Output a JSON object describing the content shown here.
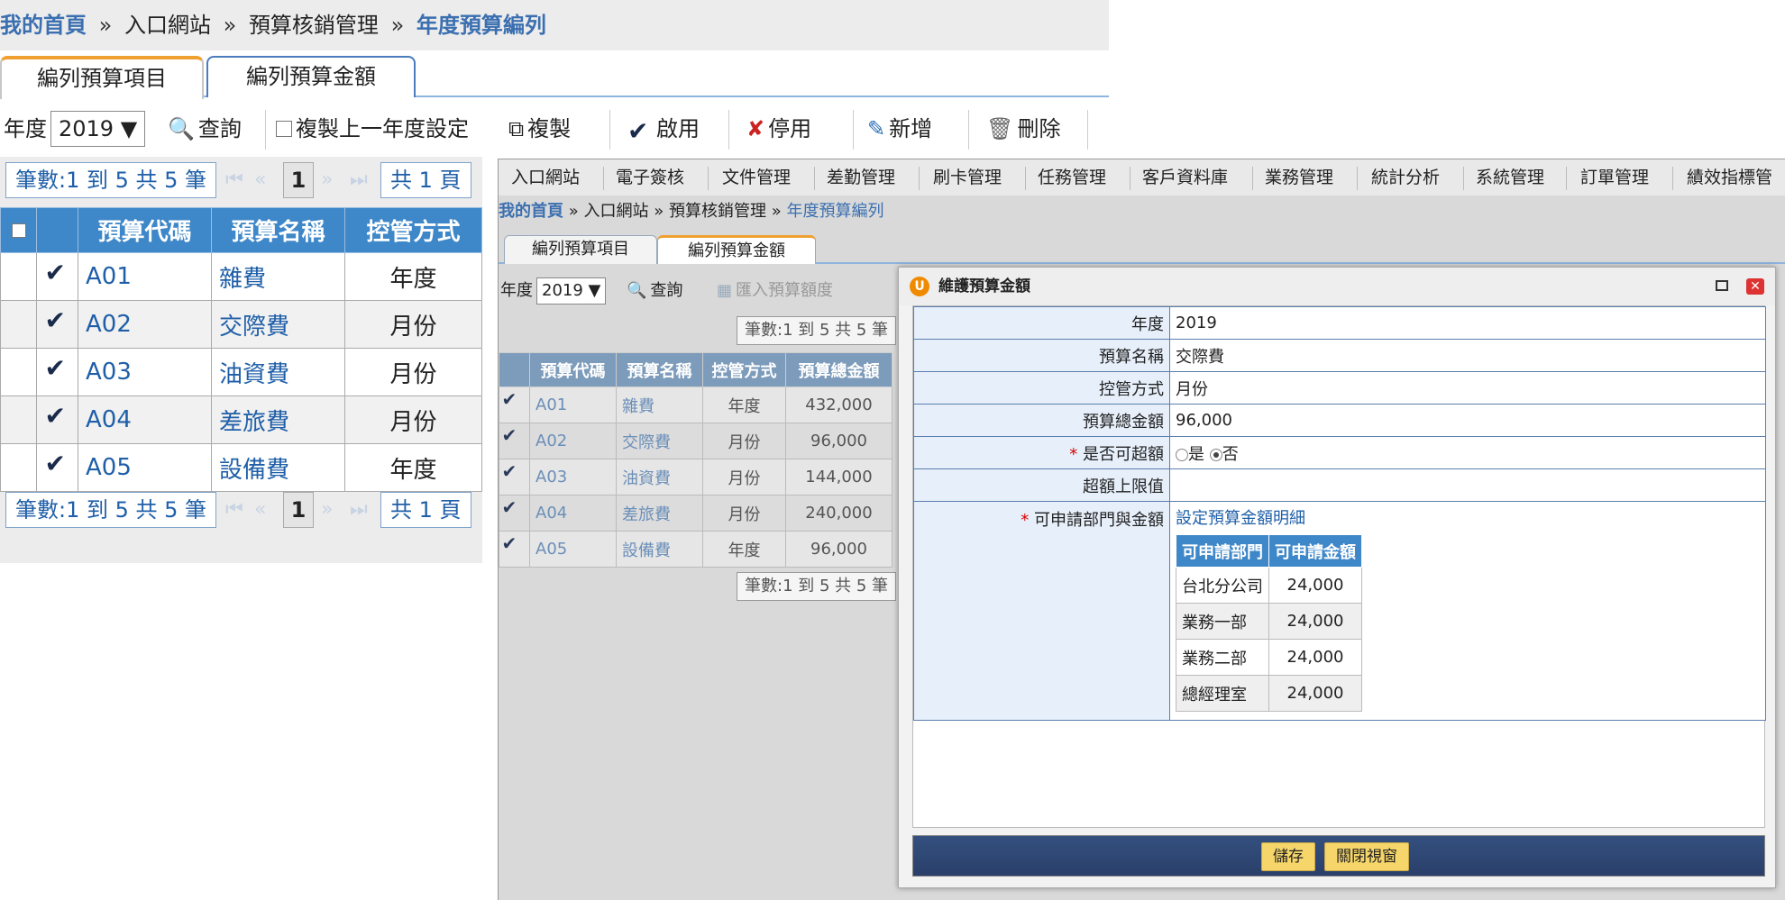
{
  "background_window": {
    "breadcrumb": [
      "我的首頁",
      "入口網站",
      "預算核銷管理",
      "年度預算編列"
    ],
    "breadcrumb_sep": "»",
    "tabs": [
      "編列預算項目",
      "編列預算金額"
    ],
    "toolbar": {
      "year_label": "年度",
      "year_value": "2019",
      "query": "查詢",
      "copy_prev": "複製上一年度設定",
      "copy": "複製",
      "enable": "啟用",
      "disable": "停用",
      "add": "新增",
      "delete": "刪除"
    },
    "pager": {
      "records": "筆數:1 到 5 共 5 筆",
      "page": "1",
      "total": "共 1 頁"
    },
    "columns": [
      "預算代碼",
      "預算名稱",
      "控管方式"
    ],
    "rows": [
      {
        "code": "A01",
        "name": "雜費",
        "control": "年度"
      },
      {
        "code": "A02",
        "name": "交際費",
        "control": "月份"
      },
      {
        "code": "A03",
        "name": "油資費",
        "control": "月份"
      },
      {
        "code": "A04",
        "name": "差旅費",
        "control": "月份"
      },
      {
        "code": "A05",
        "name": "設備費",
        "control": "年度"
      }
    ]
  },
  "middle_window": {
    "menu": [
      "入口網站",
      "電子簽核",
      "文件管理",
      "差勤管理",
      "刷卡管理",
      "任務管理",
      "客戶資料庫",
      "業務管理",
      "統計分析",
      "系統管理",
      "訂單管理",
      "績效指標管"
    ],
    "breadcrumb": [
      "我的首頁",
      "入口網站",
      "預算核銷管理",
      "年度預算編列"
    ],
    "tabs": [
      "編列預算項目",
      "編列預算金額"
    ],
    "toolbar": {
      "year_label": "年度",
      "year_value": "2019",
      "query": "查詢",
      "import": "匯入預算額度"
    },
    "pager_records": "筆數:1 到 5 共 5 筆",
    "columns": [
      "預算代碼",
      "預算名稱",
      "控管方式",
      "預算總金額"
    ],
    "rows": [
      {
        "code": "A01",
        "name": "雜費",
        "control": "年度",
        "total": "432,000"
      },
      {
        "code": "A02",
        "name": "交際費",
        "control": "月份",
        "total": "96,000"
      },
      {
        "code": "A03",
        "name": "油資費",
        "control": "月份",
        "total": "144,000"
      },
      {
        "code": "A04",
        "name": "差旅費",
        "control": "月份",
        "total": "240,000"
      },
      {
        "code": "A05",
        "name": "設備費",
        "control": "年度",
        "total": "96,000"
      }
    ]
  },
  "dialog": {
    "title": "維護預算金額",
    "logo_letter": "U",
    "close_glyph": "✕",
    "fields": {
      "year_label": "年度",
      "year_value": "2019",
      "name_label": "預算名稱",
      "name_value": "交際費",
      "control_label": "控管方式",
      "control_value": "月份",
      "total_label": "預算總金額",
      "total_value": "96,000",
      "overrun_label": "是否可超額",
      "overrun_yes": "是",
      "overrun_no": "否",
      "limit_label": "超額上限值",
      "limit_value": "",
      "dept_label": "可申請部門與金額",
      "dept_link": "設定預算金額明細",
      "required_mark": "*"
    },
    "dept_columns": [
      "可申請部門",
      "可申請金額"
    ],
    "dept_rows": [
      {
        "dept": "台北分公司",
        "amount": "24,000"
      },
      {
        "dept": "業務一部",
        "amount": "24,000"
      },
      {
        "dept": "業務二部",
        "amount": "24,000"
      },
      {
        "dept": "總經理室",
        "amount": "24,000"
      }
    ],
    "buttons": {
      "save": "儲存",
      "close": "關閉視窗"
    }
  }
}
